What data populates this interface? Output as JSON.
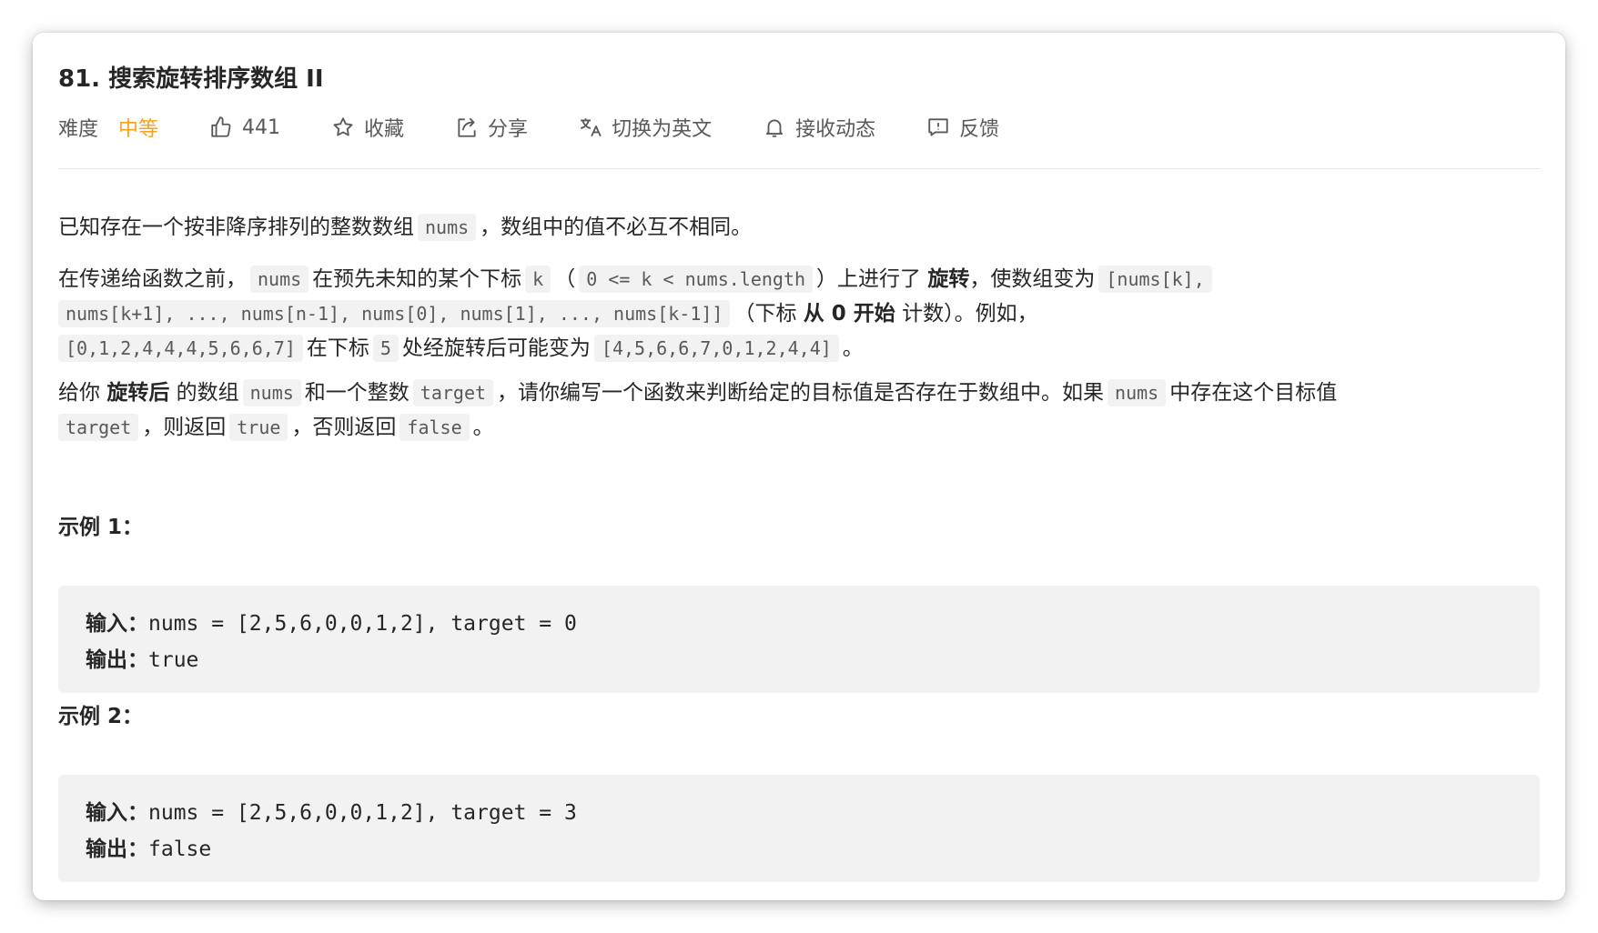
{
  "problem": {
    "title": "81. 搜索旋转排序数组 II"
  },
  "meta": {
    "difficulty_label": "难度",
    "difficulty_value": "中等",
    "likes": "441",
    "favorite": "收藏",
    "share": "分享",
    "switch_lang": "切换为英文",
    "subscribe": "接收动态",
    "feedback": "反馈",
    "colors": {
      "difficulty": "#ffa116"
    }
  },
  "desc": {
    "p1": {
      "t1": "已知存在一个按非降序排列的整数数组",
      "c1": "nums",
      "t2": "，数组中的值不必互不相同。"
    },
    "p2": {
      "t1": "在传递给函数之前，",
      "c1": "nums",
      "t2": "在预先未知的某个下标",
      "c2": "k",
      "t3": "（",
      "c3": "0 <= k < nums.length",
      "t4": "）上进行了",
      "b1": "旋转",
      "t5": "，使数组变为",
      "c4": "[nums[k],",
      "c5": "nums[k+1], ..., nums[n-1], nums[0], nums[1], ..., nums[k-1]]",
      "t6": "（下标",
      "b2": "从 0 开始",
      "t7": "计数）。例如，",
      "c6": "[0,1,2,4,4,4,5,6,6,7]",
      "t8": "在下标",
      "c7": "5",
      "t9": "处经旋转后可能变为",
      "c8": "[4,5,6,6,7,0,1,2,4,4]",
      "t10": "。"
    },
    "p3": {
      "t1": "给你",
      "b1": "旋转后",
      "t2": "的数组",
      "c1": "nums",
      "t3": "和一个整数",
      "c2": "target",
      "t4": "，请你编写一个函数来判断给定的目标值是否存在于数组中。如果",
      "c3": "nums",
      "t5": "中存在这个目标值",
      "c4": "target",
      "t6": "，则返回",
      "c5": "true",
      "t7": "，否则返回",
      "c6": "false",
      "t8": "。"
    }
  },
  "examples": [
    {
      "title": "示例 1：",
      "input_label": "输入：",
      "input_value": "nums = [2,5,6,0,0,1,2], target = 0",
      "output_label": "输出：",
      "output_value": "true"
    },
    {
      "title": "示例 2：",
      "input_label": "输入：",
      "input_value": "nums = [2,5,6,0,0,1,2], target = 3",
      "output_label": "输出：",
      "output_value": "false"
    }
  ]
}
